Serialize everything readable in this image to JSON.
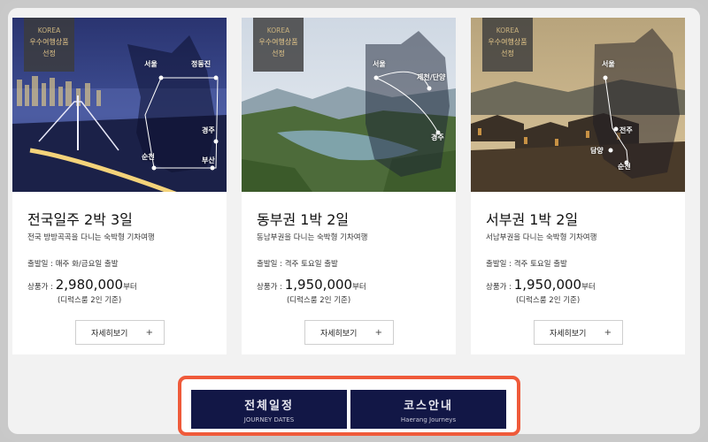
{
  "cards": [
    {
      "badge": [
        "KOREA",
        "우수여행상품",
        "선정"
      ],
      "map_labels": [
        "서울",
        "정동진",
        "경주",
        "부산",
        "순천"
      ],
      "title": "전국일주 2박 3일",
      "subtitle": "전국 방방곡곡을 다니는 숙박형 기차여행",
      "depart": "출발일 : 매주 화/금요일 출발",
      "price_label": "상품가 : ",
      "price": "2,980,000",
      "price_unit": "부터",
      "note": "(디럭스룸 2인 기준)",
      "detail_label": "자세히보기",
      "detail_icon": "+"
    },
    {
      "badge": [
        "KOREA",
        "우수여행상품",
        "선정"
      ],
      "map_labels": [
        "서울",
        "제천/단양",
        "경주"
      ],
      "title": "동부권 1박 2일",
      "subtitle": "동남부권을 다니는 숙박형 기차여행",
      "depart": "출발일 : 격주 토요일 출발",
      "price_label": "상품가 : ",
      "price": "1,950,000",
      "price_unit": "부터",
      "note": "(디럭스룸 2인 기준)",
      "detail_label": "자세히보기",
      "detail_icon": "+"
    },
    {
      "badge": [
        "KOREA",
        "우수여행상품",
        "선정"
      ],
      "map_labels": [
        "서울",
        "전주",
        "담양",
        "순천"
      ],
      "title": "서부권 1박 2일",
      "subtitle": "서남부권을 다니는 숙박형 기차여행",
      "depart": "출발일 : 격주 토요일 출발",
      "price_label": "상품가 : ",
      "price": "1,950,000",
      "price_unit": "부터",
      "note": "(디럭스룸 2인 기준)",
      "detail_label": "자세히보기",
      "detail_icon": "+"
    }
  ],
  "tabs": [
    {
      "ko": "전체일정",
      "en": "JOURNEY DATES"
    },
    {
      "ko": "코스안내",
      "en": "Haerang Journeys"
    }
  ],
  "colors": {
    "tab_bg": "#121746",
    "highlight": "#ef5a3a",
    "badge_text": "#e6c88a"
  }
}
